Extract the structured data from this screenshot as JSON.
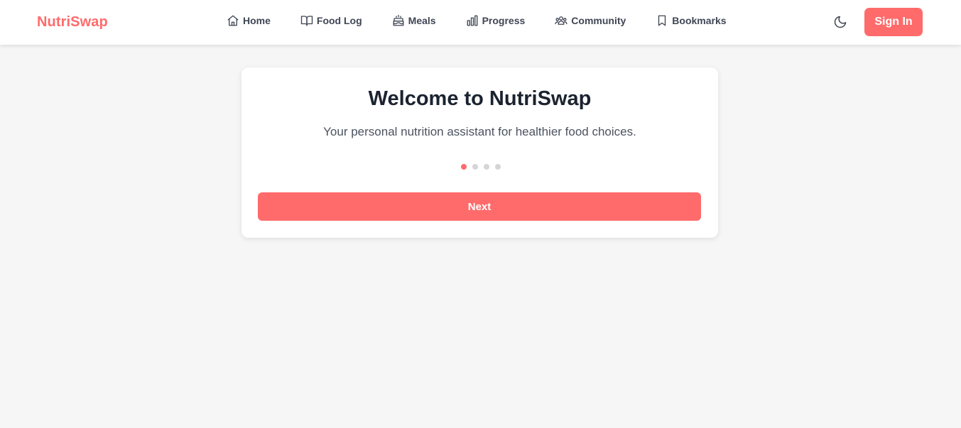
{
  "app": {
    "brand": "NutriSwap"
  },
  "nav": {
    "items": [
      {
        "label": "Home",
        "icon": "home-icon"
      },
      {
        "label": "Food Log",
        "icon": "book-icon"
      },
      {
        "label": "Meals",
        "icon": "cake-icon"
      },
      {
        "label": "Progress",
        "icon": "bar-chart-icon"
      },
      {
        "label": "Community",
        "icon": "users-icon"
      },
      {
        "label": "Bookmarks",
        "icon": "bookmark-icon"
      }
    ],
    "theme_icon": "moon-icon",
    "signin_label": "Sign In"
  },
  "onboarding": {
    "title": "Welcome to NutriSwap",
    "subtitle": "Your personal nutrition assistant for healthier food choices.",
    "step_current": 1,
    "step_total": 4,
    "next_label": "Next"
  },
  "colors": {
    "accent": "#ff6b6b",
    "nav_text": "#3f4654",
    "background": "#f6f6f6",
    "dot_inactive": "#d5d5d9"
  }
}
